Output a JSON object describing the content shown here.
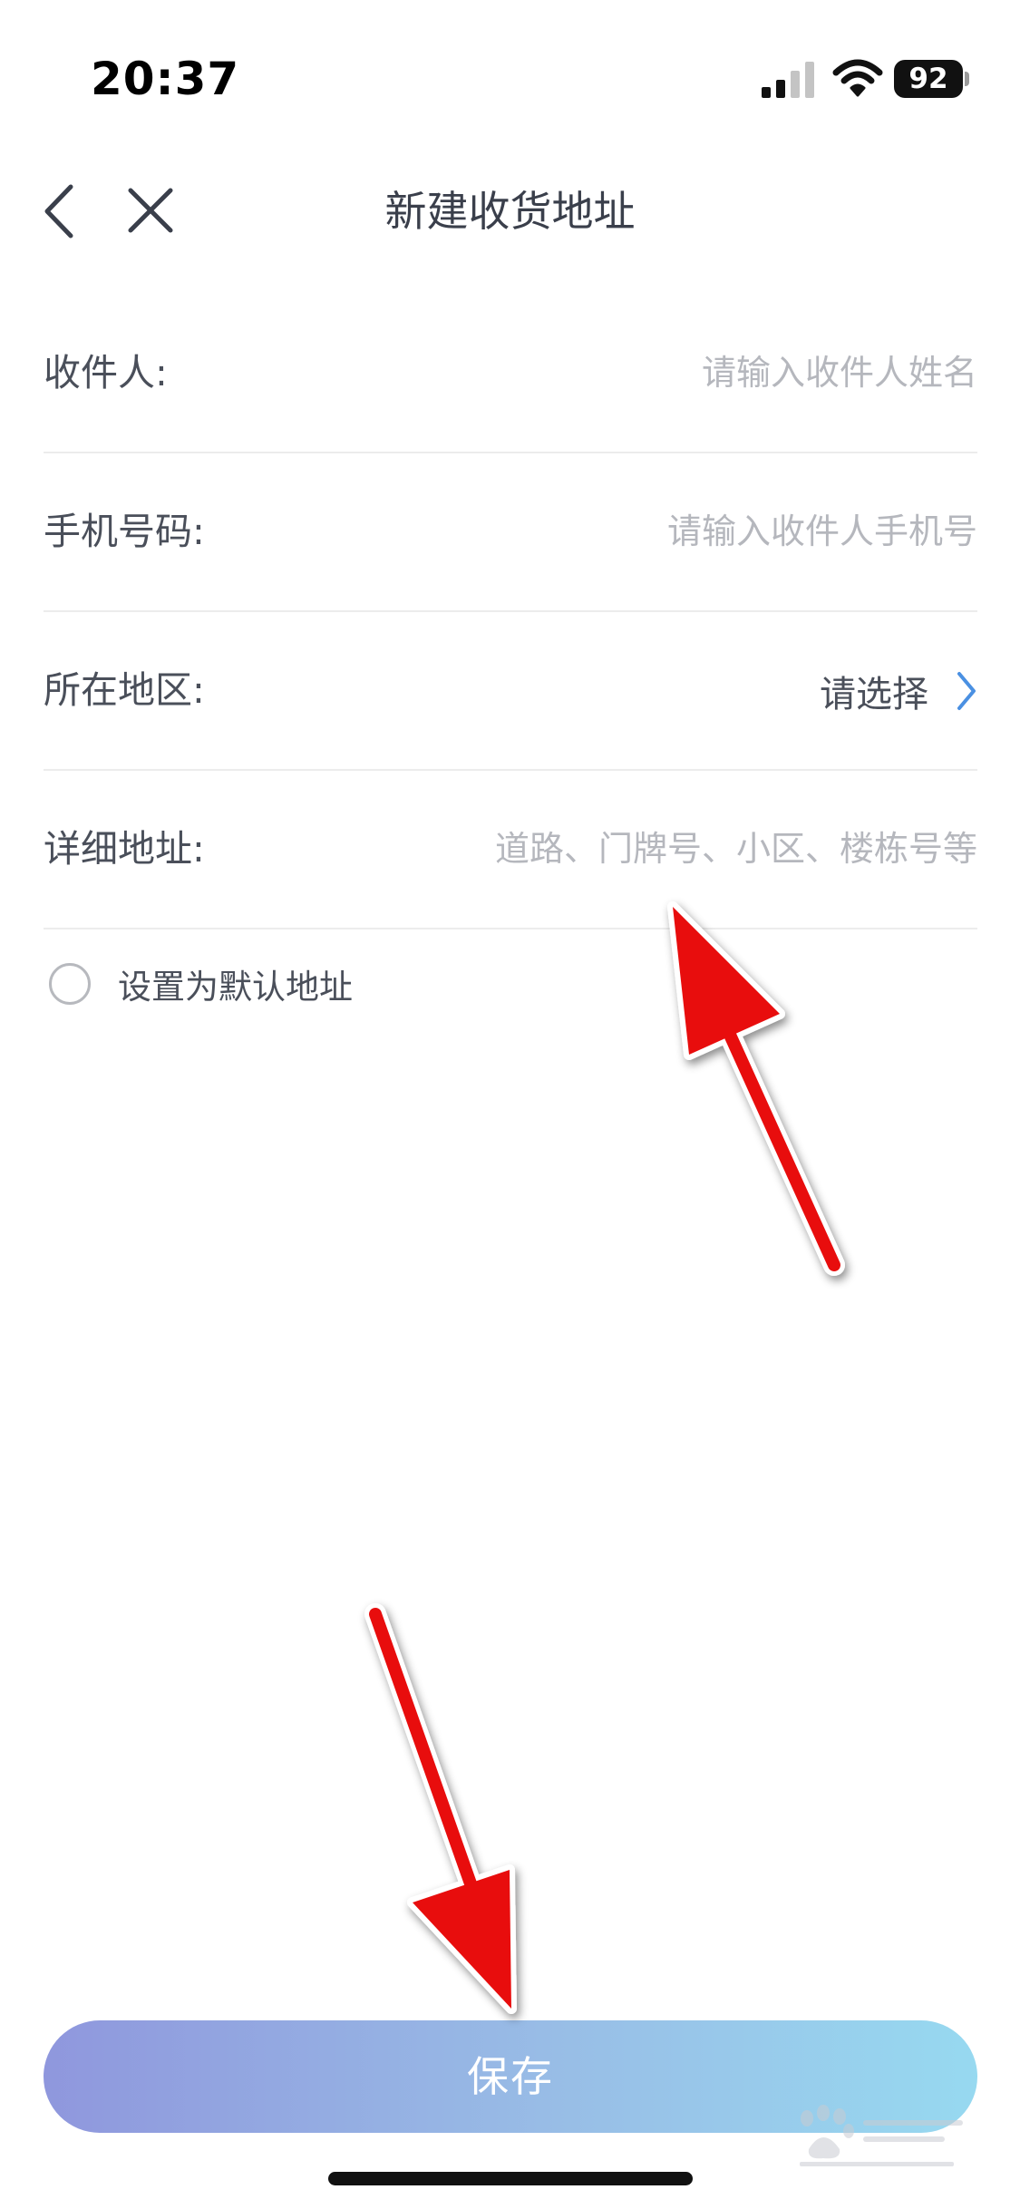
{
  "status_bar": {
    "time": "20:37",
    "battery": "92",
    "icons": [
      "signal-icon",
      "wifi-icon",
      "battery-icon"
    ]
  },
  "nav": {
    "title": "新建收货地址",
    "icons": [
      "chevron-left-icon",
      "close-icon"
    ]
  },
  "form": {
    "recipient": {
      "label": "收件人:",
      "value": "",
      "placeholder": "请输入收件人姓名"
    },
    "phone": {
      "label": "手机号码:",
      "value": "",
      "placeholder": "请输入收件人手机号"
    },
    "region": {
      "label": "所在地区:",
      "value": "请选择"
    },
    "detail": {
      "label": "详细地址:",
      "value": "",
      "placeholder": "道路、门牌号、小区、楼栋号等"
    },
    "default_address": {
      "label": "设置为默认地址",
      "checked": false
    }
  },
  "save_button": {
    "label": "保存"
  },
  "colors": {
    "accent_blue": "#4a90e2",
    "button_gradient_start": "#8f97dd",
    "button_gradient_end": "#97d9f0",
    "annotation_arrow": "#e81010"
  }
}
